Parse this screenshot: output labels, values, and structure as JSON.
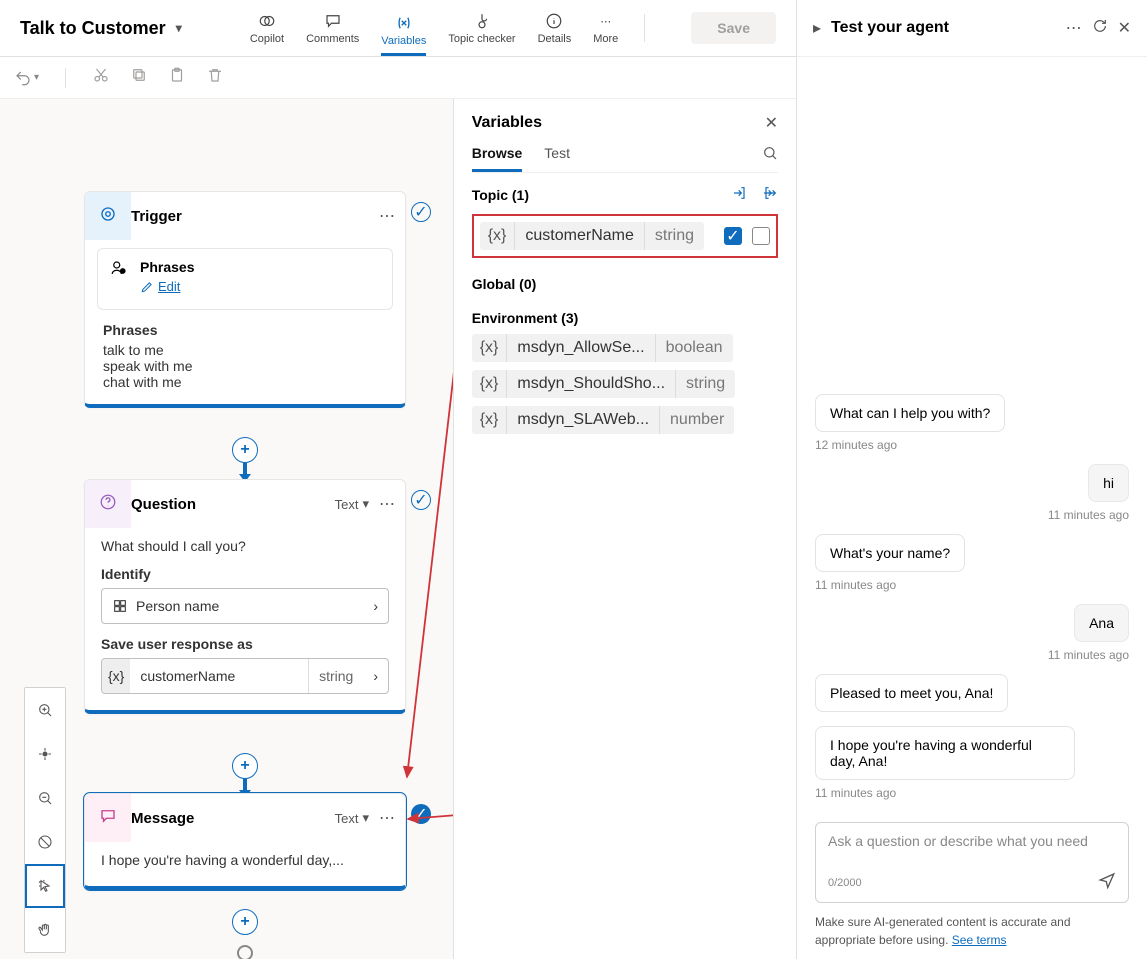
{
  "header": {
    "title": "Talk to Customer",
    "save_label": "Save",
    "tools": {
      "copilot": "Copilot",
      "comments": "Comments",
      "variables": "Variables",
      "topic_checker": "Topic checker",
      "details": "Details",
      "more": "More"
    }
  },
  "canvas": {
    "trigger": {
      "title": "Trigger",
      "phrases_card_title": "Phrases",
      "edit_label": "Edit",
      "phrases_header": "Phrases",
      "phrases": [
        "talk to me",
        "speak with me",
        "chat with me"
      ]
    },
    "question": {
      "title": "Question",
      "type_label": "Text",
      "prompt": "What should I call you?",
      "identify_label": "Identify",
      "identify_value": "Person name",
      "save_as_label": "Save user response as",
      "var_name": "customerName",
      "var_type": "string"
    },
    "message": {
      "title": "Message",
      "type_label": "Text",
      "body": "I hope you're having a wonderful day,..."
    }
  },
  "variables_panel": {
    "title": "Variables",
    "tabs": {
      "browse": "Browse",
      "test": "Test"
    },
    "topic_header": "Topic (1)",
    "global_header": "Global (0)",
    "env_header": "Environment (3)",
    "topic_vars": [
      {
        "name": "customerName",
        "type": "string",
        "in": true,
        "out": false
      }
    ],
    "env_vars": [
      {
        "name": "msdyn_AllowSe...",
        "type": "boolean"
      },
      {
        "name": "msdyn_ShouldSho...",
        "type": "string"
      },
      {
        "name": "msdyn_SLAWeb...",
        "type": "number"
      }
    ]
  },
  "test_panel": {
    "title": "Test your agent",
    "messages": [
      {
        "from": "bot",
        "text": "What can I help you with?",
        "ts": "12 minutes ago"
      },
      {
        "from": "user",
        "text": "hi",
        "ts": "11 minutes ago"
      },
      {
        "from": "bot",
        "text": "What's your name?",
        "ts": "11 minutes ago"
      },
      {
        "from": "user",
        "text": "Ana",
        "ts": "11 minutes ago"
      },
      {
        "from": "bot",
        "text": "Pleased to meet you, Ana!",
        "ts": ""
      },
      {
        "from": "bot",
        "text": "I hope you're having a wonderful day, Ana!",
        "ts": "11 minutes ago"
      }
    ],
    "input_placeholder": "Ask a question or describe what you need",
    "char_count": "0/2000",
    "footer": "Make sure AI-generated content is accurate and appropriate before using. ",
    "footer_link": "See terms"
  }
}
